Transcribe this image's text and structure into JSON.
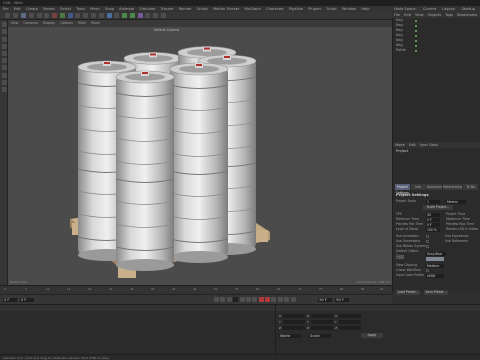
{
  "window": {
    "title": "C4D - Main"
  },
  "menubar": {
    "items": [
      "File",
      "Edit",
      "Create",
      "Modes",
      "Select",
      "Tools",
      "Mesh",
      "Snap",
      "Animate",
      "Simulate",
      "Tracker",
      "Render",
      "Sculpt",
      "Motion Tracker",
      "MoGraph",
      "Character",
      "Pipeline",
      "Plugins",
      "Script",
      "Window",
      "Help"
    ],
    "right_items": [
      "Node Space:",
      "Current",
      "Layout:",
      "Startup"
    ]
  },
  "viewport": {
    "menu": [
      "View",
      "Cameras",
      "Display",
      "Options",
      "Filter",
      "Panel"
    ],
    "camera_label": "Default Camera",
    "footer_left": "Perspective",
    "footer_right": "Grid Spacing : 100 cm"
  },
  "object_manager": {
    "menu": [
      "File",
      "Edit",
      "View",
      "Objects",
      "Tags",
      "Bookmarks"
    ],
    "rows": [
      "Keg",
      "Keg",
      "Keg",
      "Keg",
      "Keg",
      "Keg",
      "Pallet"
    ]
  },
  "attributes": {
    "menu": [
      "Mode",
      "Edit",
      "User Data"
    ],
    "title": "Project",
    "tabs": [
      "Project Settings",
      "Info",
      "Dynamics",
      "Referencing",
      "To Do"
    ],
    "section": "Project Settings",
    "scale_label": "Project Scale",
    "scale_value": "1",
    "scale_unit": "Meters",
    "scale_button": "Scale Project...",
    "fields": [
      {
        "label": "FPS",
        "value": "30",
        "right_label": "Project Time"
      },
      {
        "label": "Minimum Time",
        "value": "0 F",
        "right_label": "Maximum Time"
      },
      {
        "label": "Preview Min Time",
        "value": "0 F",
        "right_label": "Preview Max Time"
      },
      {
        "label": "Level of Detail",
        "value": "100 %",
        "right_label": "Render LOD in Editor"
      }
    ],
    "checks": [
      {
        "label": "Use Animation",
        "right_label": "Use Expression"
      },
      {
        "label": "Use Generators",
        "right_label": "Use Deformers"
      },
      {
        "label": "Use Motion System",
        "right_label": ""
      }
    ],
    "default_object_color_label": "Default Object Color",
    "default_object_color": "Gray-Blue",
    "color_label": "Color",
    "view_clipping_label": "View Clipping",
    "view_clipping": "Medium",
    "linear_workflow": "Linear Workflow",
    "input_color_profile_label": "Input Color Profile",
    "input_color_profile": "sRGB",
    "node_button": "Load Preset...",
    "save_button": "Save Preset..."
  },
  "timeline": {
    "ticks": [
      "0",
      "5",
      "10",
      "15",
      "20",
      "25",
      "30",
      "35",
      "40",
      "45",
      "50",
      "55",
      "60",
      "65",
      "70",
      "75",
      "80",
      "85",
      "90"
    ],
    "frame_start": "0 F",
    "frame_current": "0 F",
    "frame_end": "90 F",
    "frame_end2": "90 F"
  },
  "coords": {
    "labels": [
      "X",
      "Y",
      "Z"
    ],
    "dropdowns": [
      "World",
      "Scale"
    ],
    "apply": "Apply"
  },
  "status": {
    "text": "Azimuth: 0.0°; Click and drag to rotate the camera. Hold CTRL to dolly."
  }
}
